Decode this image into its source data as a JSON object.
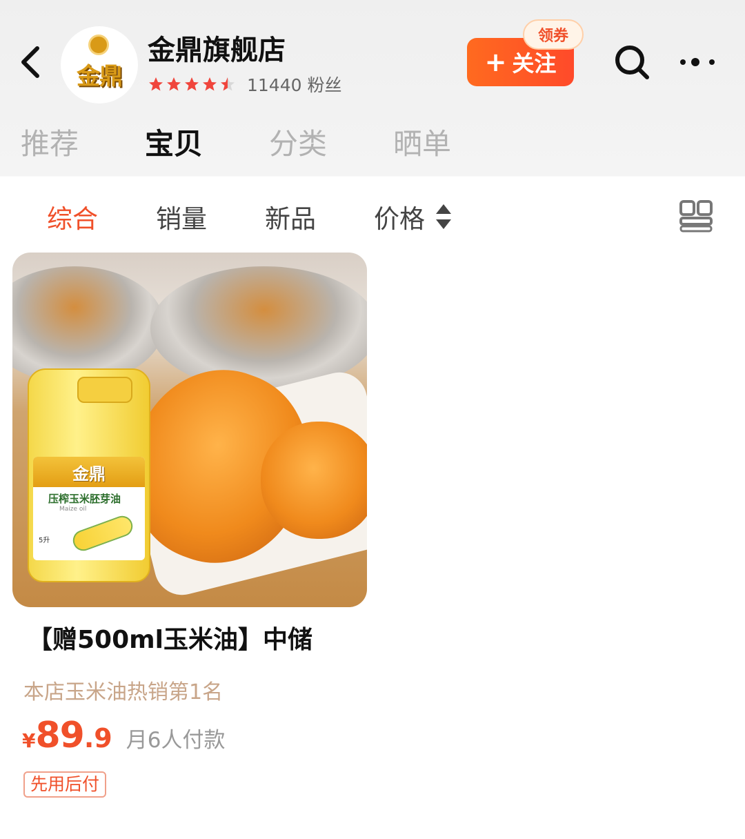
{
  "header": {
    "store_name": "金鼎旗舰店",
    "logo_text": "金鼎",
    "rating_stars": 4.5,
    "fans": "11440 粉丝",
    "follow_label": "关注",
    "follow_icon": "plus-icon",
    "coupon_label": "领券",
    "back_icon": "chevron-left-icon",
    "search_icon": "search-icon",
    "more_icon": "more-dots-icon"
  },
  "tabs": [
    {
      "label": "推荐",
      "active": false
    },
    {
      "label": "宝贝",
      "active": true
    },
    {
      "label": "分类",
      "active": false
    },
    {
      "label": "晒单",
      "active": false
    }
  ],
  "sort_bar": {
    "items": [
      {
        "label": "综合",
        "active": true
      },
      {
        "label": "销量",
        "active": false
      },
      {
        "label": "新品",
        "active": false
      },
      {
        "label": "价格",
        "active": false
      }
    ],
    "price_sort_icon": "sort-arrows-icon",
    "view_toggle_icon": "grid-view-icon"
  },
  "products": [
    {
      "title": "【赠500ml玉米油】中储",
      "rank_text": "本店玉米油热销第1名",
      "currency": "¥",
      "price_int": "89",
      "price_dec": ".9",
      "sales_text": "月6人付款",
      "tag": "先用后付",
      "image": {
        "bottle_brand": "金鼎",
        "bottle_type": "压榨玉米胚芽油",
        "bottle_sub": "Maize oil",
        "bottle_volume": "5升"
      }
    }
  ],
  "colors": {
    "accent": "#f0502a",
    "rank_text": "#c8a589",
    "star": "#f0453c"
  }
}
